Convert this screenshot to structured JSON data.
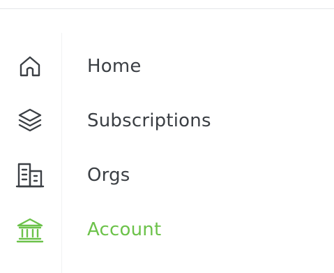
{
  "sidebar": {
    "accent_color": "#6cc24a",
    "text_color": "#3b3f44",
    "items": [
      {
        "label": "Home",
        "icon": "home-icon",
        "active": false
      },
      {
        "label": "Subscriptions",
        "icon": "layers-icon",
        "active": false
      },
      {
        "label": "Orgs",
        "icon": "buildings-icon",
        "active": false
      },
      {
        "label": "Account",
        "icon": "bank-icon",
        "active": true
      }
    ]
  }
}
